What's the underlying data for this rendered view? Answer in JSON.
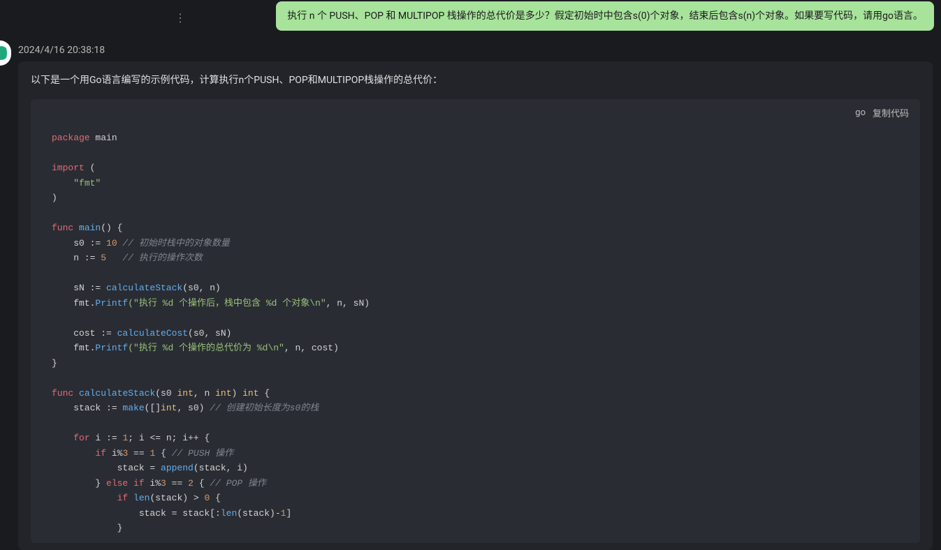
{
  "user_message": "执行 n 个 PUSH、POP 和 MULTIPOP 栈操作的总代价是多少？假定初始时中包含s(0)个对象，结束后包含s(n)个对象。如果要写代码，请用go语言。",
  "more_icon": "⋮",
  "timestamp": "2024/4/16 20:38:18",
  "assistant_intro": "以下是一个用Go语言编写的示例代码，计算执行n个PUSH、POP和MULTIPOP栈操作的总代价：",
  "code": {
    "lang_label": "go",
    "copy_label": "复制代码",
    "t": {
      "package": "package",
      "main_id": "main",
      "import": "import",
      "lparen": "(",
      "rparen": ")",
      "fmt_str": "\"fmt\"",
      "func": "func",
      "main_fn": "main",
      "lbrace": "{",
      "rbrace": "}",
      "s0_decl": "    s0 := ",
      "ten": "10",
      "cmt_s0": " // 初始时栈中的对象数量",
      "n_decl": "    n := ",
      "five": "5",
      "cmt_n": "   // 执行的操作次数",
      "sN_line_a": "    sN := ",
      "calcStack": "calculateStack",
      "sN_args": "(s0, n)",
      "printf1_a": "    fmt.",
      "Printf": "Printf",
      "printf1_s": "(\"执行 %d 个操作后，栈中包含 %d 个对象\\n\"",
      "printf1_b": ", n, sN)",
      "cost_line_a": "    cost := ",
      "calcCost": "calculateCost",
      "cost_args": "(s0, sN)",
      "printf2_s": "(\"执行 %d 个操作的总代价为 %d\\n\"",
      "printf2_b": ", n, cost)",
      "func2_sig_a": "(s0 ",
      "int": "int",
      "func2_sig_b": ", n ",
      "func2_sig_c": ") ",
      "stack_decl_a": "    stack := ",
      "make": "make",
      "stack_decl_b": "([]",
      "stack_decl_c": ", s0) ",
      "cmt_stack": "// 创建初始长度为s0的栈",
      "for": "for",
      "for_init": " i := ",
      "one": "1",
      "for_cond": "; i <= n; i++ {",
      "if": "if",
      "mod3_1_a": " i%",
      "three": "3",
      "mod3_1_b": " == ",
      "cmt_push": "// PUSH 操作",
      "append_a": "            stack = ",
      "append": "append",
      "append_b": "(stack, i)",
      "else_if": "else if",
      "two": "2",
      "cmt_pop": "// POP 操作",
      "len": "len",
      "iflen_a": "(stack) > ",
      "zero": "0",
      "slice_a": "                stack = stack[:",
      "slice_b": "(stack)-",
      "slice_c": "]",
      "closebr_inner": "            }",
      "closebr_elseif": "        } "
    }
  }
}
